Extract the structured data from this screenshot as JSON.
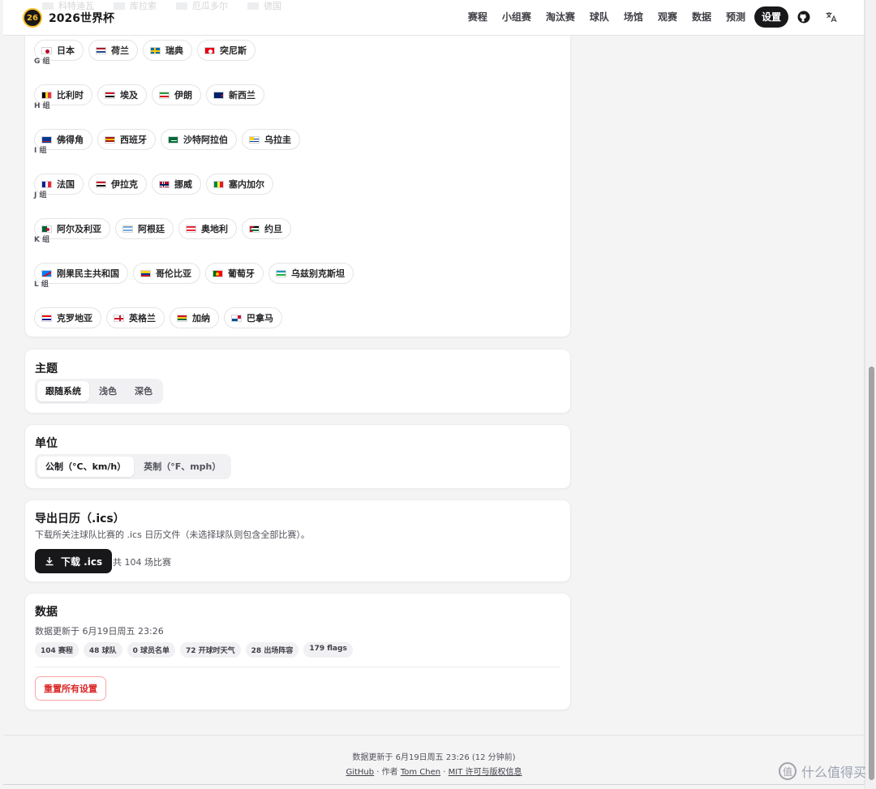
{
  "header": {
    "brand_title": "2026世界杯",
    "brand_logo_text": "26",
    "faded_teams": [
      "科特迪瓦",
      "库拉索",
      "厄瓜多尔",
      "德国"
    ],
    "nav": [
      "赛程",
      "小组赛",
      "淘汰赛",
      "球队",
      "场馆",
      "观赛",
      "数据",
      "预测",
      "设置"
    ],
    "active_nav": "设置"
  },
  "groups": [
    {
      "label": "",
      "teams": [
        {
          "name": "日本",
          "flag": "jp"
        },
        {
          "name": "荷兰",
          "flag": "nl"
        },
        {
          "name": "瑞典",
          "flag": "se"
        },
        {
          "name": "突尼斯",
          "flag": "tn"
        }
      ]
    },
    {
      "label": "G 组",
      "teams": [
        {
          "name": "比利时",
          "flag": "be"
        },
        {
          "name": "埃及",
          "flag": "eg"
        },
        {
          "name": "伊朗",
          "flag": "ir"
        },
        {
          "name": "新西兰",
          "flag": "nz"
        }
      ]
    },
    {
      "label": "H 组",
      "teams": [
        {
          "name": "佛得角",
          "flag": "cv"
        },
        {
          "name": "西班牙",
          "flag": "es"
        },
        {
          "name": "沙特阿拉伯",
          "flag": "sa"
        },
        {
          "name": "乌拉圭",
          "flag": "uy"
        }
      ]
    },
    {
      "label": "I 组",
      "teams": [
        {
          "name": "法国",
          "flag": "fr"
        },
        {
          "name": "伊拉克",
          "flag": "iq"
        },
        {
          "name": "挪威",
          "flag": "no"
        },
        {
          "name": "塞内加尔",
          "flag": "sn"
        }
      ]
    },
    {
      "label": "J 组",
      "teams": [
        {
          "name": "阿尔及利亚",
          "flag": "dz"
        },
        {
          "name": "阿根廷",
          "flag": "ar"
        },
        {
          "name": "奥地利",
          "flag": "at"
        },
        {
          "name": "约旦",
          "flag": "jo"
        }
      ]
    },
    {
      "label": "K 组",
      "teams": [
        {
          "name": "刚果民主共和国",
          "flag": "cd"
        },
        {
          "name": "哥伦比亚",
          "flag": "co"
        },
        {
          "name": "葡萄牙",
          "flag": "pt"
        },
        {
          "name": "乌兹别克斯坦",
          "flag": "uz"
        }
      ]
    },
    {
      "label": "L 组",
      "teams": [
        {
          "name": "克罗地亚",
          "flag": "hr"
        },
        {
          "name": "英格兰",
          "flag": "en"
        },
        {
          "name": "加纳",
          "flag": "gh"
        },
        {
          "name": "巴拿马",
          "flag": "pa"
        }
      ]
    }
  ],
  "theme": {
    "title": "主题",
    "options": [
      "跟随系统",
      "浅色",
      "深色"
    ],
    "selected": "跟随系统"
  },
  "units": {
    "title": "单位",
    "options": [
      "公制（°C、km/h）",
      "英制（°F、mph）"
    ],
    "selected": "公制（°C、km/h）"
  },
  "calendar": {
    "title": "导出日历（.ics）",
    "description": "下载所关注球队比赛的 .ics 日历文件（未选择球队则包含全部比赛）。",
    "button_label": "下载 .ics",
    "count_text": "共 104 场比赛"
  },
  "data_section": {
    "title": "数据",
    "updated_text": "数据更新于 6月19日周五 23:26",
    "badges": [
      "104 赛程",
      "48 球队",
      "0 球员名单",
      "72 开球时天气",
      "28 出场阵容",
      "179 flags"
    ],
    "reset_label": "重置所有设置"
  },
  "footer": {
    "updated_text": "数据更新于 6月19日周五 23:26 (12 分钟前)",
    "github_label": "GitHub",
    "author_prefix": "· 作者",
    "author_name": "Tom Chen",
    "license_label": "MIT 许可与版权信息"
  },
  "watermark": {
    "text": "什么值得买"
  },
  "colors": {
    "accent": "#18181b",
    "danger": "#dc2626"
  }
}
